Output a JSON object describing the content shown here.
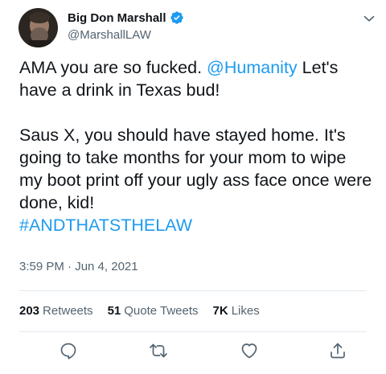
{
  "author": {
    "display_name": "Big Don Marshall",
    "handle": "@MarshallLAW",
    "verified": true
  },
  "tweet": {
    "line1_pre": "AMA you are so fucked. ",
    "mention": "@Humanity",
    "line1_post": " Let's have a drink  in Texas bud!",
    "paragraph2": "Saus X, you should have stayed home. It's going to take months for your mom to wipe my boot print off your ugly ass face once were done, kid!",
    "hashtag": "#ANDTHATSTHELAW"
  },
  "timestamp": "3:59 PM · Jun 4, 2021",
  "stats": {
    "retweets_count": "203",
    "retweets_label": "Retweets",
    "quote_count": "51",
    "quote_label": "Quote Tweets",
    "likes_count": "7K",
    "likes_label": "Likes"
  },
  "icons": {
    "caret": "chevron-down-icon",
    "verified": "verified-badge-icon",
    "reply": "reply-icon",
    "retweet": "retweet-icon",
    "like": "heart-icon",
    "share": "share-icon"
  },
  "colors": {
    "accent": "#1d9bf0",
    "secondary_text": "#536471",
    "primary_text": "#0f1419",
    "divider": "#e1e8ed"
  }
}
